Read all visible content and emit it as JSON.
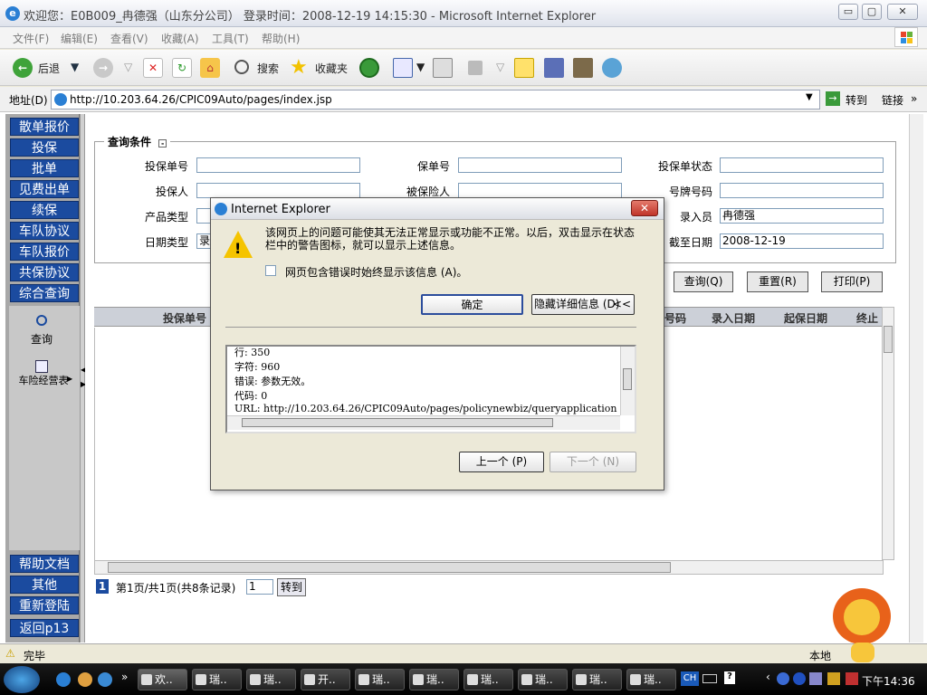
{
  "window": {
    "title": "欢迎您：E0B009_冉德强（山东分公司）  登录时间：2008-12-19 14:15:30 - Microsoft Internet Explorer",
    "controls": [
      "▭",
      "▢",
      "✕"
    ]
  },
  "menu": [
    "文件(F)",
    "编辑(E)",
    "查看(V)",
    "收藏(A)",
    "工具(T)",
    "帮助(H)"
  ],
  "toolbar": {
    "back": "后退",
    "search": "搜索",
    "favorites": "收藏夹"
  },
  "address": {
    "label": "地址(D)",
    "url": "http://10.203.64.26/CPIC09Auto/pages/index.jsp",
    "go": "转到",
    "links": "链接"
  },
  "sidebar": {
    "top_items": [
      "散单报价",
      "投保",
      "批单",
      "见费出单",
      "续保",
      "车队协议",
      "车队报价",
      "共保协议",
      "综合查询"
    ],
    "query_label": "查询",
    "report_label": "车险经营表",
    "bottom_items": [
      "帮助文档",
      "其他",
      "重新登陆",
      "返回p13"
    ]
  },
  "form": {
    "legend": "查询条件",
    "fields": {
      "policy_app_no": {
        "label": "投保单号",
        "value": ""
      },
      "policy_no": {
        "label": "保单号",
        "value": ""
      },
      "app_status": {
        "label": "投保单状态",
        "value": ""
      },
      "applicant": {
        "label": "投保人",
        "value": ""
      },
      "insured": {
        "label": "被保险人",
        "value": ""
      },
      "plate_no": {
        "label": "号牌号码",
        "value": ""
      },
      "product_type": {
        "label": "产品类型",
        "value": ""
      },
      "entry_person": {
        "label": "录入员",
        "value": "冉德强"
      },
      "date_type": {
        "label": "日期类型",
        "value": "录"
      },
      "end_date": {
        "label": "截至日期",
        "value": "2008-12-19"
      }
    },
    "buttons": {
      "query": "查询(Q)",
      "reset": "重置(R)",
      "print": "打印(P)"
    }
  },
  "grid": {
    "columns": [
      "投保单号",
      "号码",
      "录入日期",
      "起保日期",
      "终止"
    ]
  },
  "pager": {
    "page_no": "1",
    "summary": "第1页/共1页(共8条记录)",
    "input": "1",
    "go": "转到"
  },
  "status": {
    "text": "完毕",
    "zone": "本地"
  },
  "taskbar": {
    "tasks": [
      "欢..",
      "瑞..",
      "瑞..",
      "开..",
      "瑞..",
      "瑞..",
      "瑞..",
      "瑞..",
      "瑞..",
      "瑞.."
    ],
    "lang": "CH",
    "clock": "下午14:36"
  },
  "dialog": {
    "title": "Internet Explorer",
    "message": "该网页上的问题可能使其无法正常显示或功能不正常。以后，双击显示在状态栏中的警告图标，就可以显示上述信息。",
    "checkbox_label": "网页包含错误时始终显示该信息 (A)。",
    "ok": "确定",
    "hide_details": "隐藏详细信息 (D)",
    "details": [
      "行:  350",
      "字符: 960",
      "错误: 参数无效。",
      "代码: 0",
      "URL:  http://10.203.64.26/CPIC09Auto/pages/policynewbiz/queryapplication"
    ],
    "prev": "上一个 (P)",
    "next": "下一个 (N)"
  },
  "colors": {
    "nav_blue": "#1b4b9f",
    "sidebar_gray": "#a8a8a8",
    "dialog_bg": "#ece9d8"
  }
}
